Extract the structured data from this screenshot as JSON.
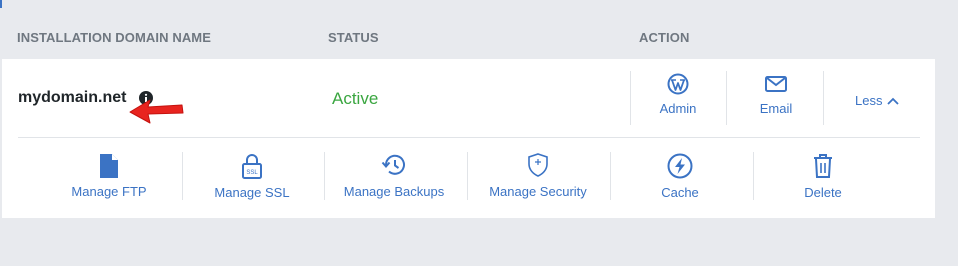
{
  "headers": {
    "domain": "INSTALLATION DOMAIN NAME",
    "status": "STATUS",
    "action": "ACTION"
  },
  "installation": {
    "domain": "mydomain.net",
    "status": "Active",
    "status_color": "#3aa640"
  },
  "top_actions": [
    {
      "label": "Admin",
      "icon": "wordpress-icon"
    },
    {
      "label": "Email",
      "icon": "envelope-icon"
    }
  ],
  "toggle": {
    "label": "Less",
    "icon": "chevron-up-icon"
  },
  "bottom_actions": [
    {
      "label": "Manage FTP",
      "icon": "file-icon"
    },
    {
      "label": "Manage SSL",
      "icon": "ssl-lock-icon"
    },
    {
      "label": "Manage Backups",
      "icon": "history-clock-icon"
    },
    {
      "label": "Manage Security",
      "icon": "shield-icon"
    },
    {
      "label": "Cache",
      "icon": "lightning-icon"
    },
    {
      "label": "Delete",
      "icon": "trash-icon"
    }
  ],
  "colors": {
    "accent": "#3b73c4",
    "background": "#e8eaee",
    "card": "#ffffff",
    "arrow": "#e8241f"
  }
}
